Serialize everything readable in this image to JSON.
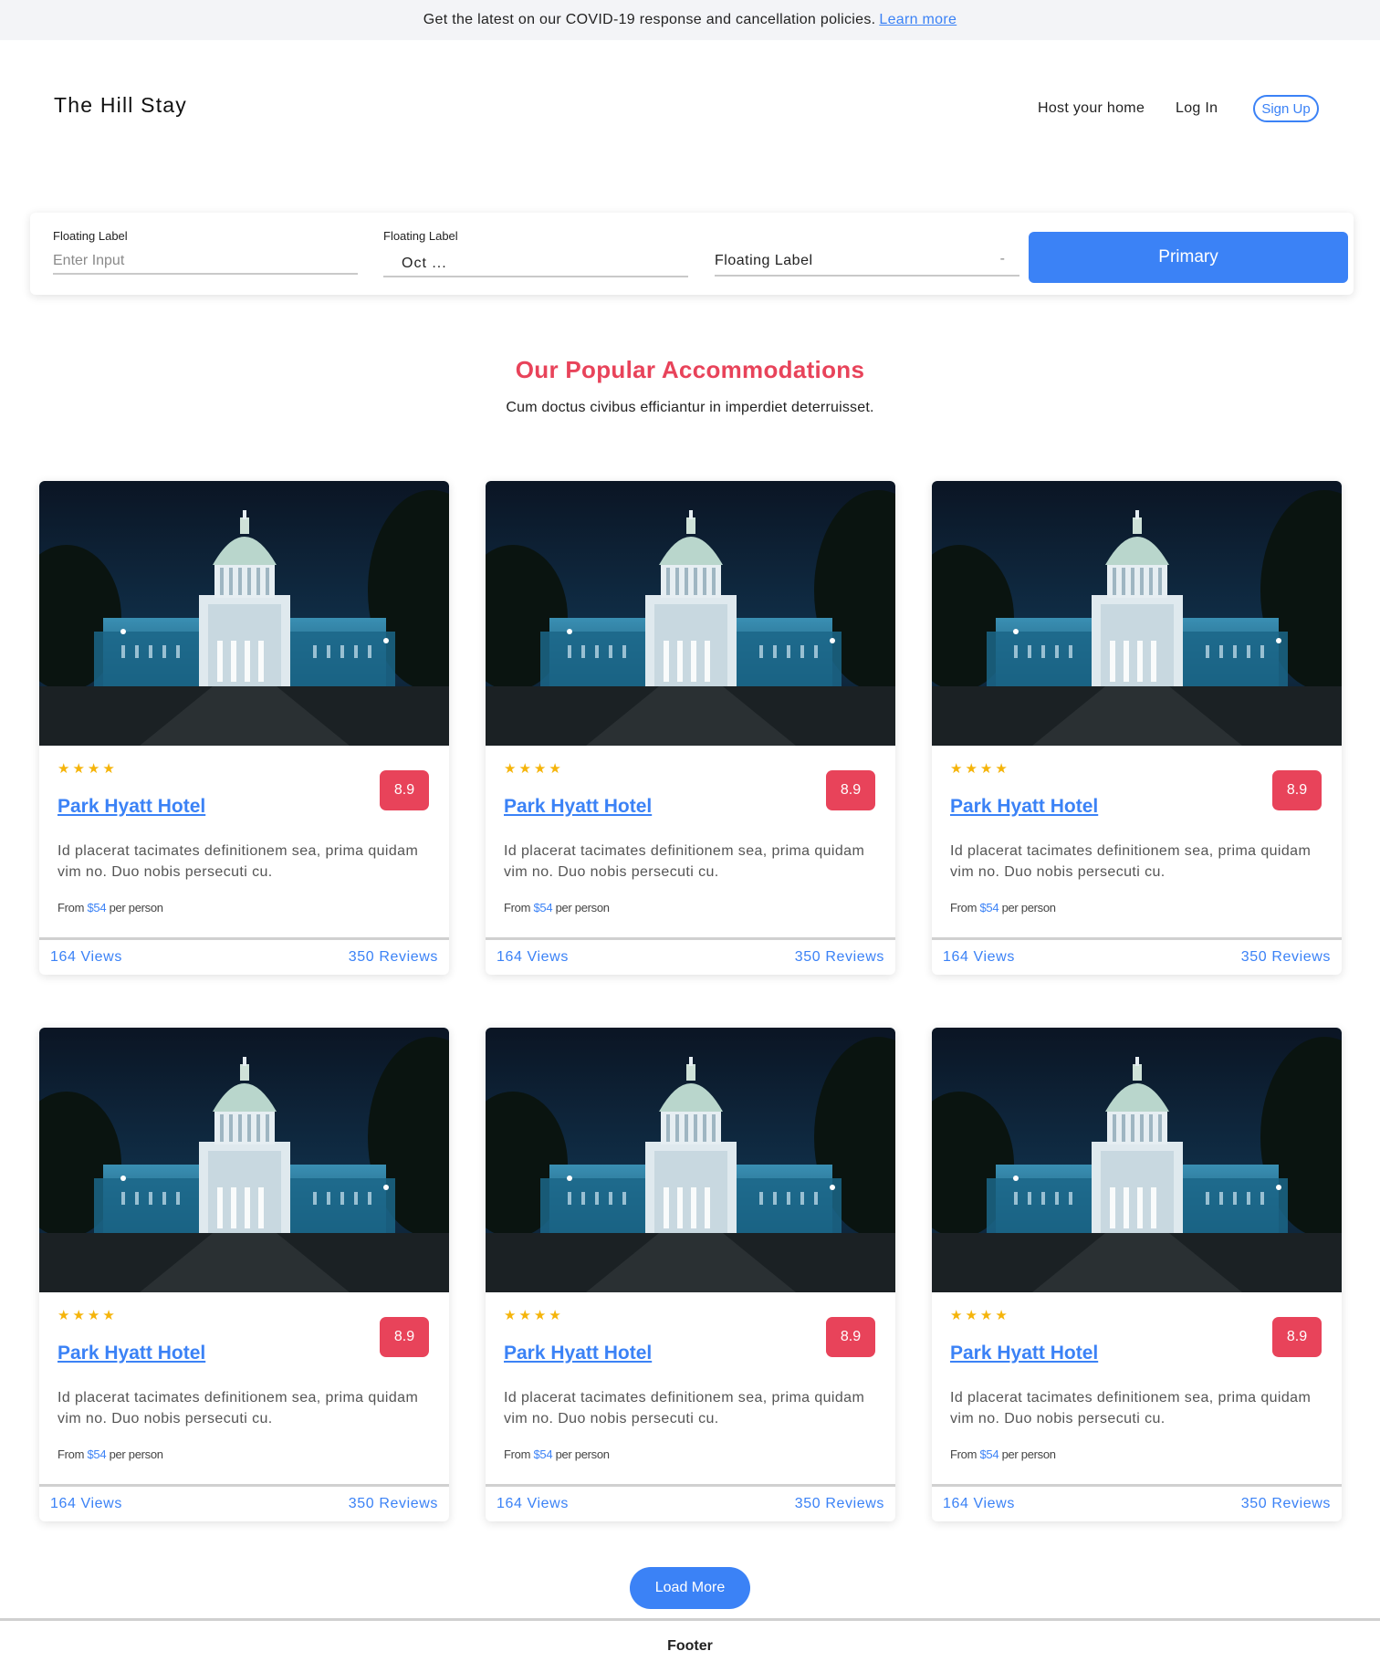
{
  "banner": {
    "text": "Get the latest on our COVID-19 response and cancellation policies.",
    "link": "Learn more"
  },
  "header": {
    "logo": "The Hill Stay",
    "nav": {
      "host": "Host your home",
      "login": "Log In",
      "signup": "Sign Up"
    }
  },
  "search": {
    "field1": {
      "label": "Floating Label",
      "placeholder": "Enter Input"
    },
    "field2": {
      "label": "Floating Label",
      "value": "Oct ..."
    },
    "field3": {
      "value": "Floating Label",
      "caret": "-"
    },
    "button": "Primary"
  },
  "section": {
    "title": "Our Popular Accommodations",
    "subtitle": "Cum doctus civibus efficiantur in imperdiet deterruisset."
  },
  "cards": [
    {
      "stars": 4,
      "score": "8.9",
      "title": "Park Hyatt Hotel",
      "description": "Id placerat tacimates definitionem sea, prima quidam vim no. Duo nobis persecuti cu.",
      "price_from": "From",
      "price": "$54",
      "price_unit": "per person",
      "views": "164 Views",
      "reviews": "350 Reviews"
    },
    {
      "stars": 4,
      "score": "8.9",
      "title": "Park Hyatt Hotel",
      "description": "Id placerat tacimates definitionem sea, prima quidam vim no. Duo nobis persecuti cu.",
      "price_from": "From",
      "price": "$54",
      "price_unit": "per person",
      "views": "164 Views",
      "reviews": "350 Reviews"
    },
    {
      "stars": 4,
      "score": "8.9",
      "title": "Park Hyatt Hotel",
      "description": "Id placerat tacimates definitionem sea, prima quidam vim no. Duo nobis persecuti cu.",
      "price_from": "From",
      "price": "$54",
      "price_unit": "per person",
      "views": "164 Views",
      "reviews": "350 Reviews"
    },
    {
      "stars": 4,
      "score": "8.9",
      "title": "Park Hyatt Hotel",
      "description": "Id placerat tacimates definitionem sea, prima quidam vim no. Duo nobis persecuti cu.",
      "price_from": "From",
      "price": "$54",
      "price_unit": "per person",
      "views": "164 Views",
      "reviews": "350 Reviews"
    },
    {
      "stars": 4,
      "score": "8.9",
      "title": "Park Hyatt Hotel",
      "description": "Id placerat tacimates definitionem sea, prima quidam vim no. Duo nobis persecuti cu.",
      "price_from": "From",
      "price": "$54",
      "price_unit": "per person",
      "views": "164 Views",
      "reviews": "350 Reviews"
    },
    {
      "stars": 4,
      "score": "8.9",
      "title": "Park Hyatt Hotel",
      "description": "Id placerat tacimates definitionem sea, prima quidam vim no. Duo nobis persecuti cu.",
      "price_from": "From",
      "price": "$54",
      "price_unit": "per person",
      "views": "164 Views",
      "reviews": "350 Reviews"
    }
  ],
  "load_more": "Load More",
  "footer": "Footer",
  "colors": {
    "accent": "#3b82f6",
    "brand_red": "#e8435a",
    "star": "#f5b40a"
  }
}
